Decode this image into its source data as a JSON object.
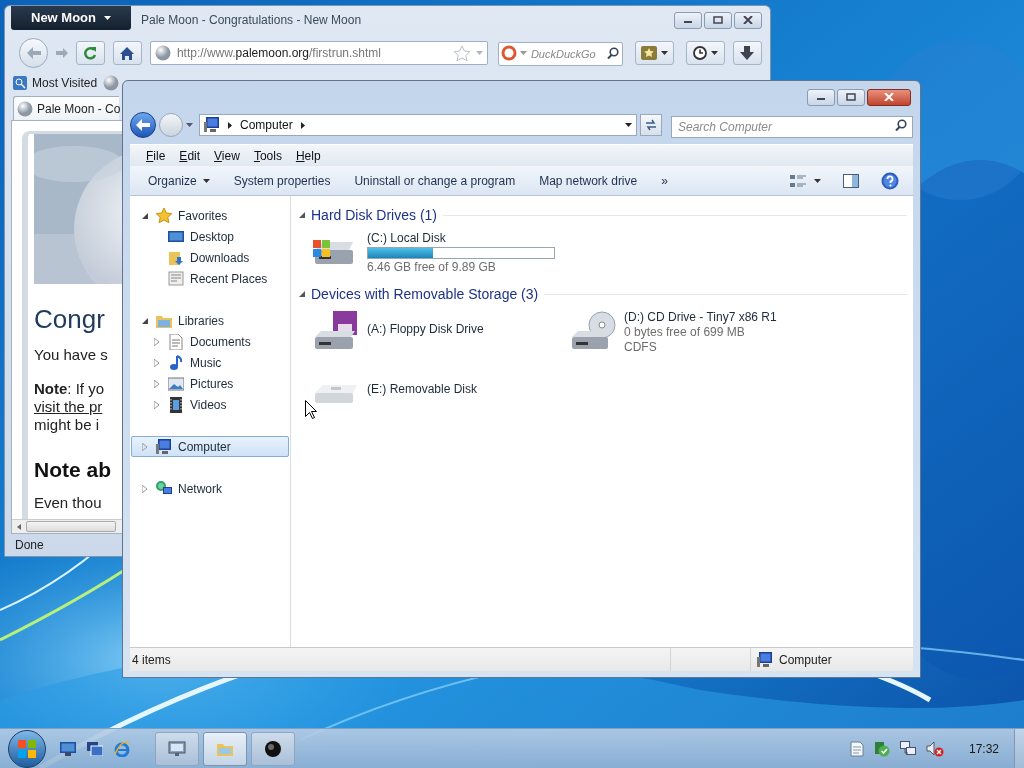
{
  "browser": {
    "app_button": "New Moon",
    "title": "Pale Moon - Congratulations - New Moon",
    "url": "http://www.**palemoon.org**/firstrun.shtml",
    "search_placeholder": "DuckDuckGo",
    "bookmarks": [
      "Most Visited"
    ],
    "tab": "Pale Moon - Co",
    "content": [
      {
        "kind": "heading",
        "text": "Congr"
      },
      {
        "kind": "text",
        "text": "You have s"
      },
      {
        "kind": "note",
        "text": "**Note**: If yo"
      },
      {
        "kind": "link",
        "text": "visit the pr"
      },
      {
        "kind": "line",
        "text": "might be i"
      },
      {
        "kind": "subheading",
        "text": "Note ab"
      },
      {
        "kind": "text",
        "text": "Even thou"
      }
    ],
    "status": "Done"
  },
  "explorer": {
    "crumbs": [
      "Computer"
    ],
    "search_placeholder": "Search Computer",
    "menu": [
      "File",
      "Edit",
      "View",
      "Tools",
      "Help"
    ],
    "commands": [
      {
        "label": "Organize",
        "dropdown": true
      },
      {
        "label": "System properties",
        "dropdown": false
      },
      {
        "label": "Uninstall or change a program",
        "dropdown": false
      },
      {
        "label": "Map network drive",
        "dropdown": false
      },
      {
        "label": "»",
        "dropdown": false
      }
    ],
    "nav": [
      {
        "label": "Favorites",
        "kind": "star",
        "expanded": true,
        "selected": false,
        "children": [
          {
            "label": "Desktop",
            "kind": "desktop",
            "selected": false
          },
          {
            "label": "Downloads",
            "kind": "downloads",
            "selected": false
          },
          {
            "label": "Recent Places",
            "kind": "recent",
            "selected": false
          }
        ]
      },
      {
        "label": "Libraries",
        "kind": "libraries",
        "expanded": true,
        "selected": false,
        "children": [
          {
            "label": "Documents",
            "kind": "documents",
            "expanded": false,
            "selected": false
          },
          {
            "label": "Music",
            "kind": "music",
            "expanded": false,
            "selected": false
          },
          {
            "label": "Pictures",
            "kind": "pictures",
            "expanded": false,
            "selected": false
          },
          {
            "label": "Videos",
            "kind": "videos",
            "expanded": false,
            "selected": false
          }
        ]
      },
      {
        "label": "Computer",
        "kind": "computer",
        "expanded": false,
        "selected": true
      },
      {
        "label": "Network",
        "kind": "network",
        "expanded": false,
        "selected": false
      }
    ],
    "groups": [
      {
        "title": "Hard Disk Drives (1)",
        "expanded": true,
        "items": [
          {
            "kind": "hdd",
            "name": "(C:) Local Disk",
            "level": 0.35,
            "details": [
              "6.46 GB free of 9.89 GB"
            ]
          }
        ]
      },
      {
        "title": "Devices with Removable Storage (3)",
        "expanded": true,
        "items": [
          {
            "kind": "floppy",
            "name": "(A:) Floppy Disk Drive"
          },
          {
            "kind": "cd",
            "name": "(D:) CD Drive - Tiny7 x86 R1",
            "details": [
              "0 bytes free of 699 MB",
              "CDFS"
            ]
          },
          {
            "kind": "removable",
            "name": "(E:) Removable Disk"
          }
        ]
      }
    ],
    "status": {
      "items": "4 items",
      "location": "Computer"
    }
  },
  "taskbar": {
    "tasks": [
      {
        "kind": "remote",
        "selected": false
      },
      {
        "kind": "folder",
        "selected": true
      },
      {
        "kind": "moon",
        "selected": false
      }
    ],
    "clock": "17:32"
  }
}
